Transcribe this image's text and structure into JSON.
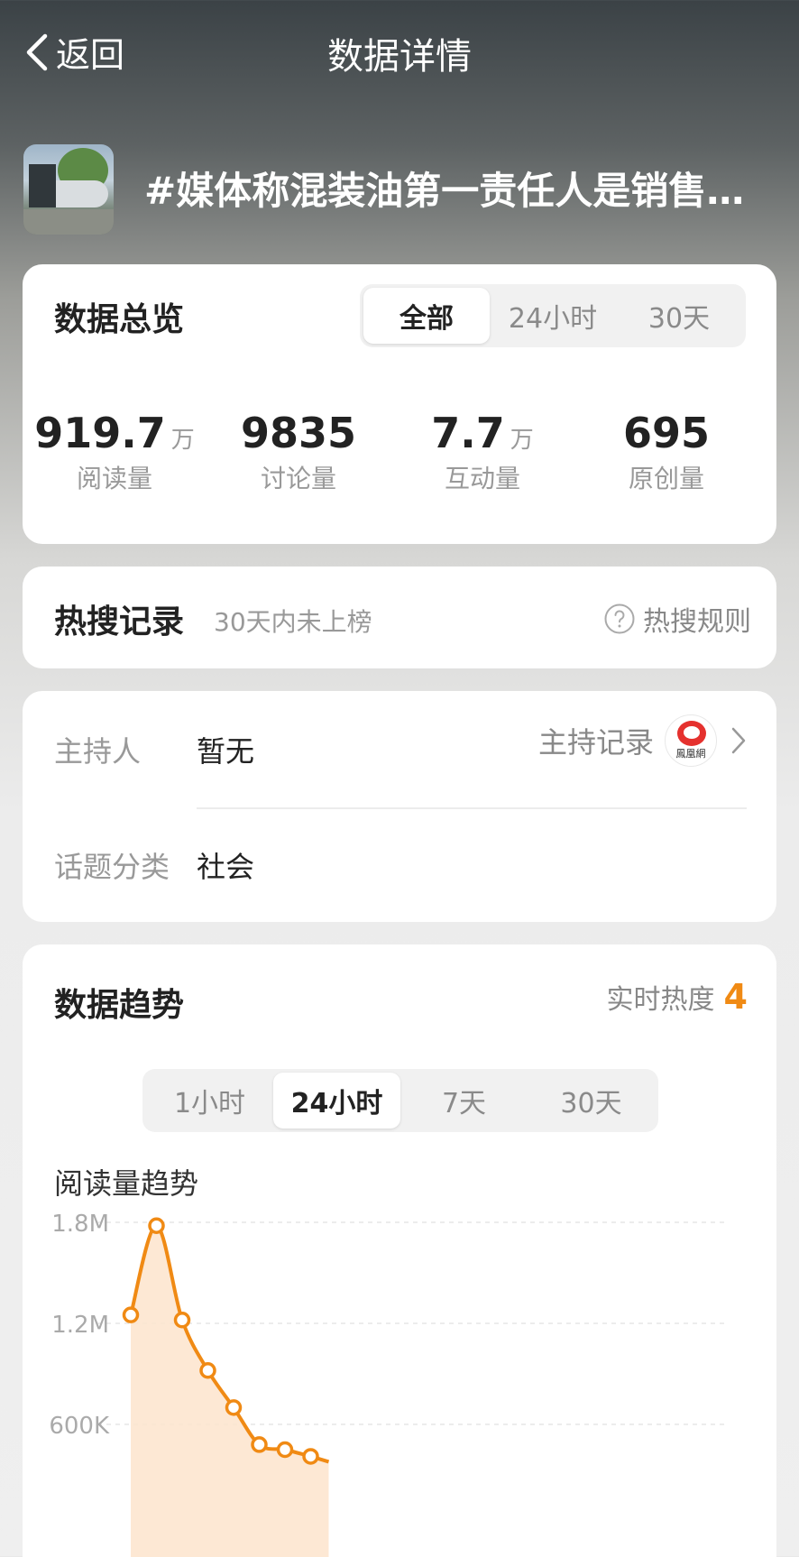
{
  "nav": {
    "back_label": "返回",
    "title": "数据详情"
  },
  "topic": {
    "title": "#媒体称混装油第一责任人是销售…"
  },
  "overview": {
    "title": "数据总览",
    "tabs": [
      "全部",
      "24小时",
      "30天"
    ],
    "active_tab": 0,
    "stats": [
      {
        "value": "919.7",
        "unit": "万",
        "label": "阅读量"
      },
      {
        "value": "9835",
        "unit": "",
        "label": "讨论量"
      },
      {
        "value": "7.7",
        "unit": "万",
        "label": "互动量"
      },
      {
        "value": "695",
        "unit": "",
        "label": "原创量"
      }
    ]
  },
  "hot_search": {
    "title": "热搜记录",
    "subtitle": "30天内未上榜",
    "rules_label": "热搜规则",
    "icon": "question-circle-icon"
  },
  "info": {
    "host_label": "主持人",
    "host_value": "暂无",
    "host_record_label": "主持记录",
    "host_logo_text": "鳳凰網",
    "category_label": "话题分类",
    "category_value": "社会"
  },
  "trend": {
    "title": "数据趋势",
    "heat_label": "实时热度",
    "heat_value": "4",
    "tabs": [
      "1小时",
      "24小时",
      "7天",
      "30天"
    ],
    "active_tab": 1,
    "chart_title": "阅读量趋势"
  },
  "colors": {
    "accent": "#f08a14",
    "line": "#f08a14",
    "fill": "#fde4cc"
  },
  "chart_data": {
    "type": "area",
    "title": "阅读量趋势",
    "y_ticks": [
      "1.8M",
      "1.2M",
      "600K"
    ],
    "y_tick_values": [
      1800000,
      1200000,
      600000
    ],
    "x": [
      1,
      2,
      3,
      4,
      5,
      6,
      7,
      8
    ],
    "values": [
      1250000,
      1780000,
      1220000,
      920000,
      700000,
      480000,
      450000,
      410000
    ],
    "grid": true
  }
}
